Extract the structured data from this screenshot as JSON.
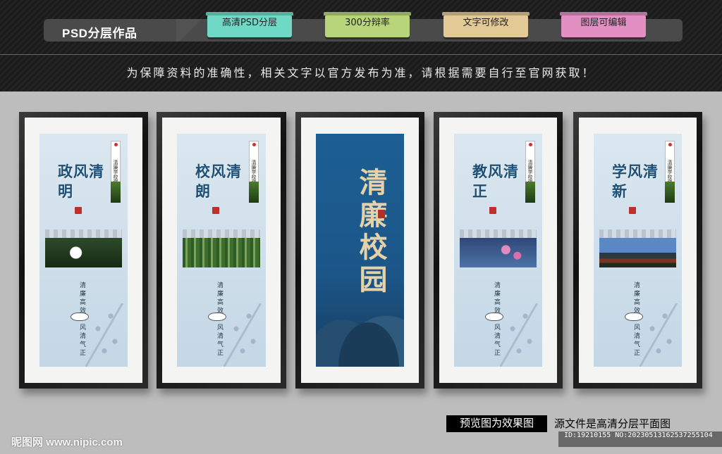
{
  "header": {
    "title": "PSD分层作品",
    "tags": [
      "高清PSD分层",
      "300分辩率",
      "文字可修改",
      "图层可编辑"
    ],
    "tag_colors": [
      "#6fd9c6",
      "#b9d57b",
      "#e2c995",
      "#e28fc4"
    ],
    "notice": "为保障资料的准确性，相关文字以官方发布为准，请根据需要自行至官网获取！"
  },
  "panels": [
    {
      "vertical_tag": "清廉学校建设",
      "title": "政风清明",
      "text_a": "清廉高效",
      "text_b": "风清气正"
    },
    {
      "vertical_tag": "清廉学校建设",
      "title": "校风清朗",
      "text_a": "清廉高效",
      "text_b": "风清气正"
    },
    {
      "center_title": "清廉校园"
    },
    {
      "vertical_tag": "清廉学校建设",
      "title": "教风清正",
      "text_a": "清廉高效",
      "text_b": "风清气正"
    },
    {
      "vertical_tag": "清廉学校建设",
      "title": "学风清新",
      "text_a": "清廉高效",
      "text_b": "风清气正"
    }
  ],
  "footer": {
    "preview_label": "预览图为效果图",
    "source_label": "源文件是高清分层平面图",
    "watermark": "昵图网 www.nipic.com",
    "id_text": "ID:19210155 NO:20230513162537255104"
  }
}
